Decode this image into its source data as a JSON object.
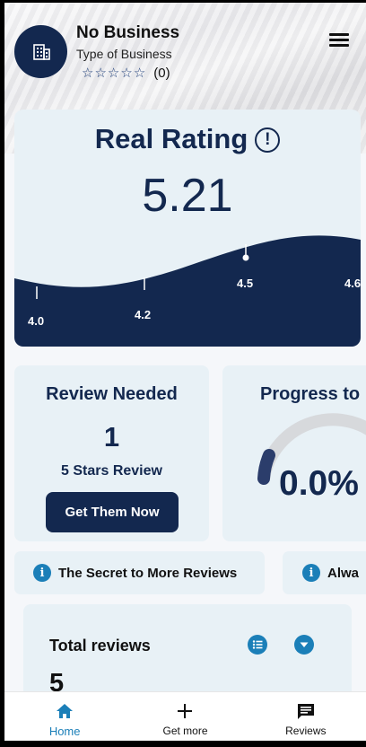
{
  "business": {
    "name": "No Business",
    "type": "Type of Business",
    "rating_stars": 0,
    "review_count_label": "(0)",
    "avatar_icon": "building-icon"
  },
  "header": {
    "menu_icon": "hamburger-menu-icon"
  },
  "real_rating": {
    "title": "Real Rating",
    "info_icon": "exclamation-circle-icon",
    "value": "5.21",
    "scale_ticks": [
      "4.0",
      "4.2",
      "4.5",
      "4.6"
    ]
  },
  "review_needed": {
    "title": "Review Needed",
    "count": "1",
    "subtitle": "5 Stars Review",
    "button_label": "Get Them Now"
  },
  "progress": {
    "title": "Progress to",
    "value": "0.0%",
    "fraction": 0.0
  },
  "tips": [
    {
      "icon": "info-icon",
      "text": "The Secret to More Reviews"
    },
    {
      "icon": "info-icon",
      "text": "Alwa"
    }
  ],
  "total_reviews": {
    "title": "Total reviews",
    "count": "5",
    "list_icon": "list-icon",
    "dropdown_icon": "chevron-down-icon"
  },
  "nav": {
    "items": [
      {
        "label": "Home",
        "icon": "home-icon",
        "active": true
      },
      {
        "label": "Get more",
        "icon": "plus-icon",
        "active": false
      },
      {
        "label": "Reviews",
        "icon": "reviews-icon",
        "active": false
      }
    ]
  },
  "colors": {
    "primary": "#13284f",
    "accent": "#1b7fb8",
    "card": "#e8f1f6"
  }
}
